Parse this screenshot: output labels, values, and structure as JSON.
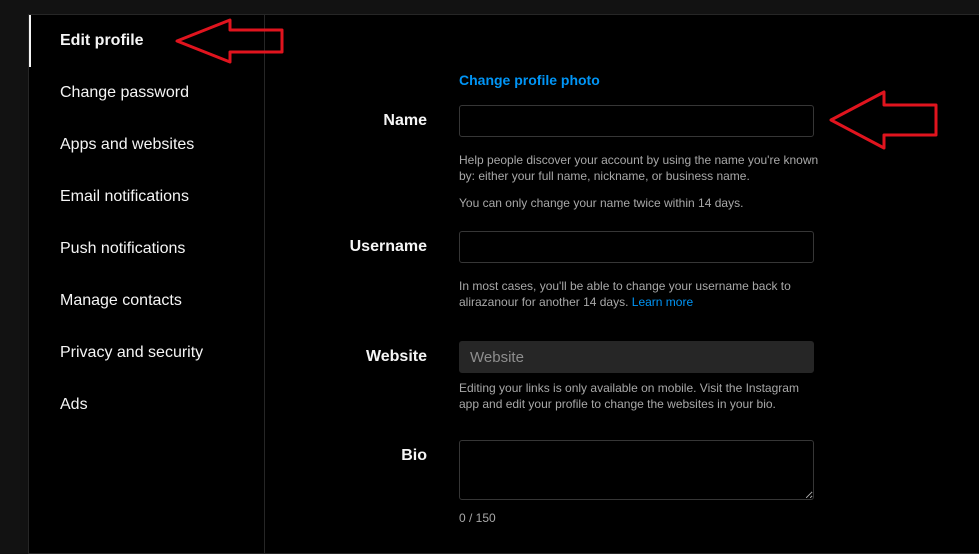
{
  "sidebar": {
    "items": [
      {
        "label": "Edit profile",
        "active": true
      },
      {
        "label": "Change password"
      },
      {
        "label": "Apps and websites"
      },
      {
        "label": "Email notifications"
      },
      {
        "label": "Push notifications"
      },
      {
        "label": "Manage contacts"
      },
      {
        "label": "Privacy and security"
      },
      {
        "label": "Ads"
      }
    ]
  },
  "form": {
    "change_photo": "Change profile photo",
    "name": {
      "label": "Name",
      "value": "",
      "help1": "Help people discover your account by using the name you're known by: either your full name, nickname, or business name.",
      "help2": "You can only change your name twice within 14 days."
    },
    "username": {
      "label": "Username",
      "value": "",
      "help_prefix": "In most cases, you'll be able to change your username back to alirazanour for another 14 days.",
      "learn_more": "Learn more"
    },
    "website": {
      "label": "Website",
      "placeholder": "Website",
      "help": "Editing your links is only available on mobile. Visit the Instagram app and edit your profile to change the websites in your bio."
    },
    "bio": {
      "label": "Bio",
      "value": "",
      "counter": "0 / 150"
    }
  },
  "colors": {
    "accent": "#0095f6",
    "annotation_arrow": "#e0141e",
    "background": "#000000"
  }
}
